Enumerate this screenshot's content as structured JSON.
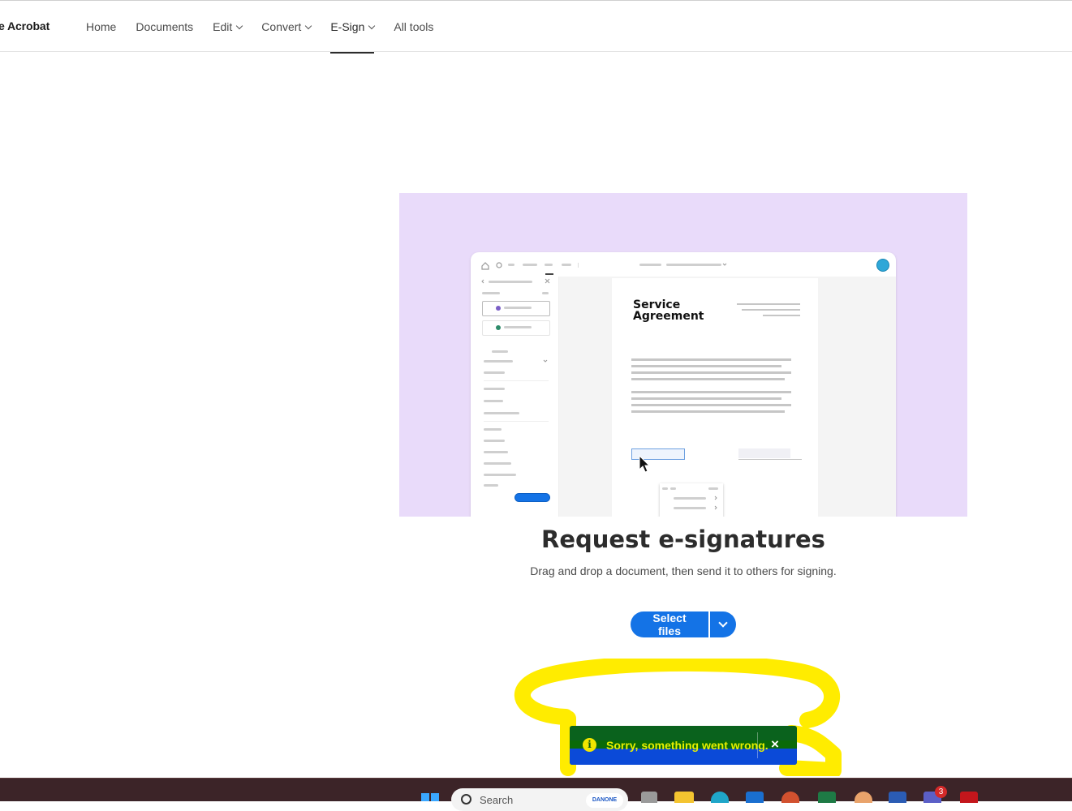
{
  "brand": {
    "name": "e Acrobat"
  },
  "nav": {
    "items": [
      {
        "label": "Home",
        "has_dropdown": false,
        "active": false
      },
      {
        "label": "Documents",
        "has_dropdown": false,
        "active": false
      },
      {
        "label": "Edit",
        "has_dropdown": true,
        "active": false
      },
      {
        "label": "Convert",
        "has_dropdown": true,
        "active": false
      },
      {
        "label": "E-Sign",
        "has_dropdown": true,
        "active": true
      },
      {
        "label": "All tools",
        "has_dropdown": false,
        "active": false
      }
    ]
  },
  "hero": {
    "doc_title": "Service\nAgreement",
    "background_color": "#e9dbfa"
  },
  "main": {
    "title": "Request e-signatures",
    "subtitle": "Drag and drop a document, then send it to others for signing.",
    "select_files_label": "Select files",
    "accent_color": "#1473e6"
  },
  "toast": {
    "message": "Sorry, something went wrong.",
    "icon": "info-icon",
    "close_glyph": "×"
  },
  "taskbar": {
    "search_placeholder": "Search",
    "search_badge": "DANONE",
    "teams_badge_count": "3",
    "icons": [
      "windows-start-icon",
      "file-manager-icon",
      "folder-icon",
      "edge-icon",
      "outlook-icon",
      "powerpoint-icon",
      "excel-icon",
      "paint-icon",
      "word-icon",
      "teams-icon",
      "acrobat-icon"
    ]
  }
}
